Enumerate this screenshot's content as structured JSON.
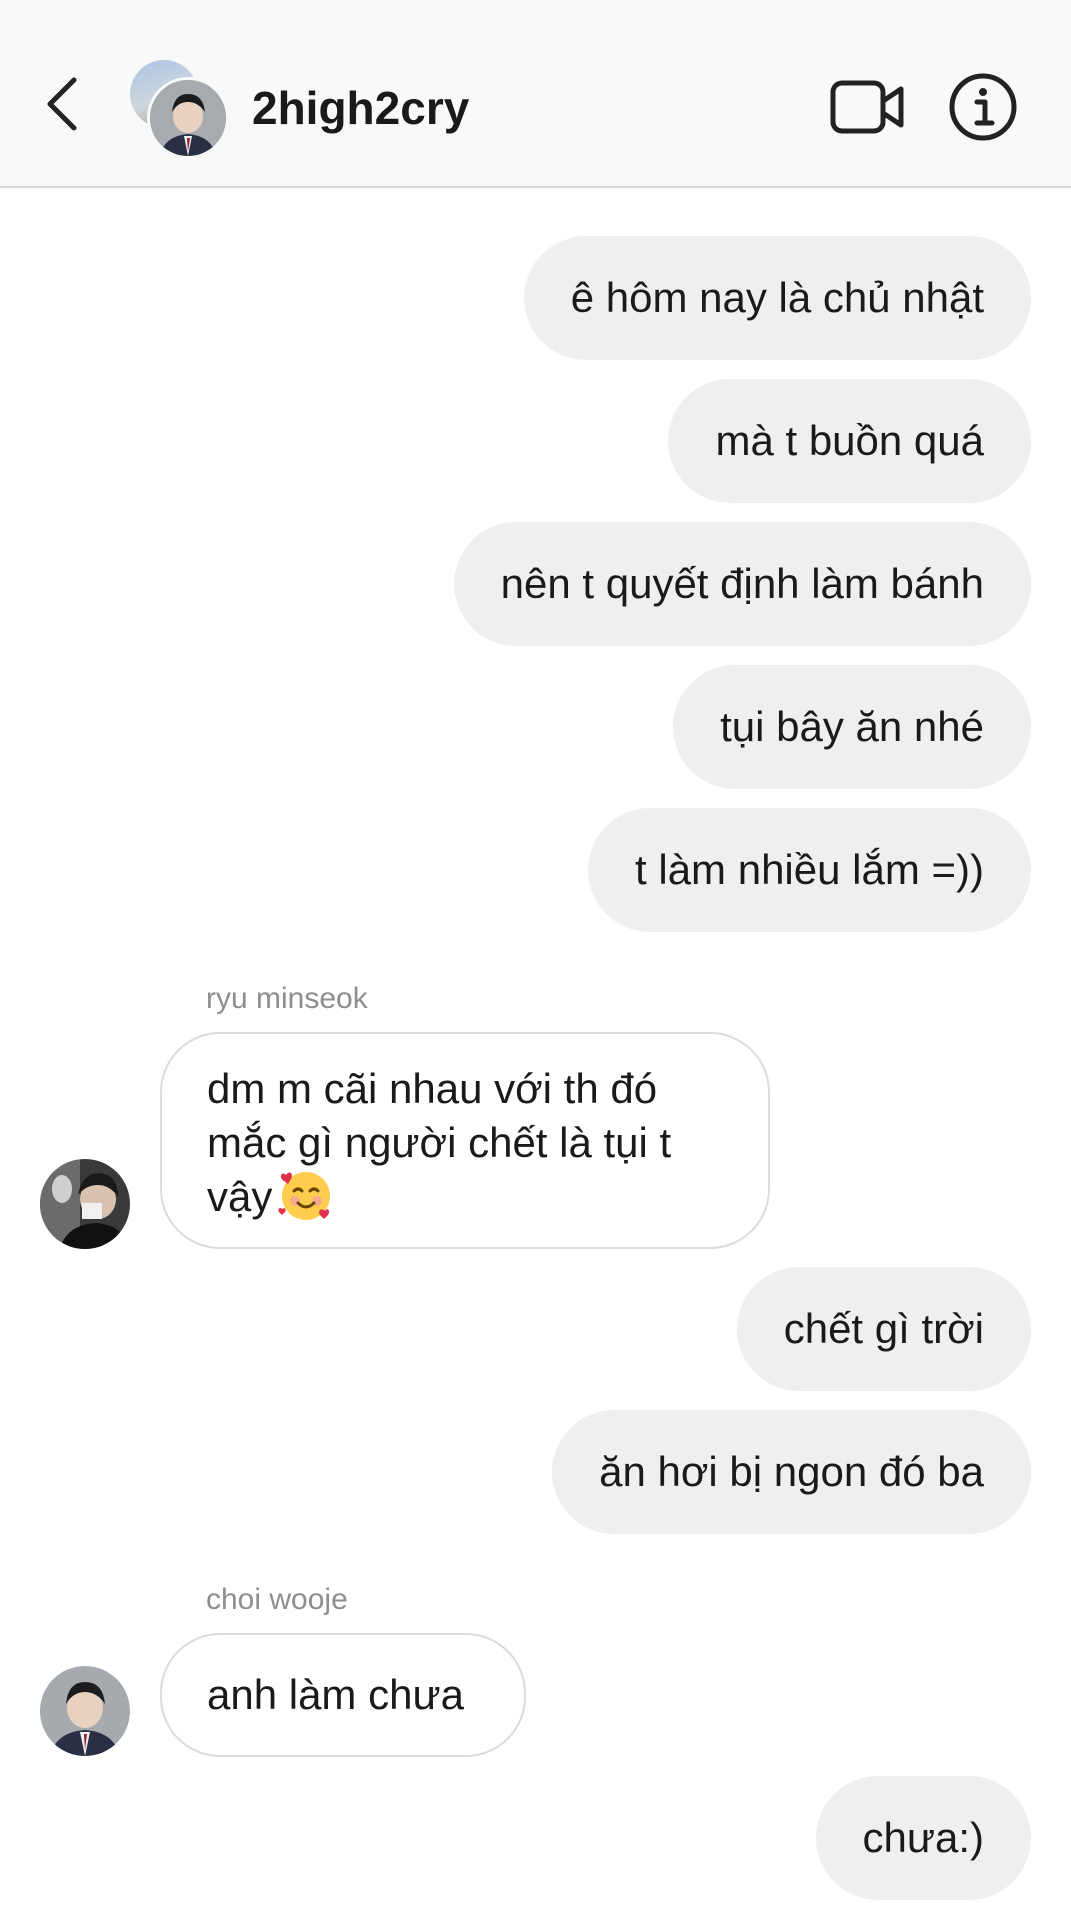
{
  "header": {
    "title": "2high2cry",
    "back_icon": "chevron-left-icon",
    "video_icon": "video-camera-icon",
    "info_icon": "info-icon"
  },
  "messages": [
    {
      "direction": "out",
      "text": "ê hôm nay là chủ nhật"
    },
    {
      "direction": "out",
      "text": "mà t buồn quá"
    },
    {
      "direction": "out",
      "text": "nên t quyết định làm bánh"
    },
    {
      "direction": "out",
      "text": "tụi bây ăn nhé"
    },
    {
      "direction": "out",
      "text": "t làm nhiều lắm =))"
    },
    {
      "direction": "in",
      "sender": "ryu minseok",
      "lines": [
        "dm m cãi nhau với th đó",
        "mắc gì người chết là tụi t",
        "vậy"
      ],
      "emoji": "smiling-face-with-hearts-emoji"
    },
    {
      "direction": "out",
      "text": "chết gì trời"
    },
    {
      "direction": "out",
      "text": "ăn hơi bị ngon đó ba"
    },
    {
      "direction": "in",
      "sender": "choi wooje",
      "text": "anh làm chưa"
    },
    {
      "direction": "out",
      "text": "chưa:)"
    }
  ],
  "colors": {
    "header_bg": "#f9f9f9",
    "outgoing_bubble": "#efefef",
    "incoming_border": "#dbdbdb",
    "sender_name": "#8e8e8e"
  }
}
